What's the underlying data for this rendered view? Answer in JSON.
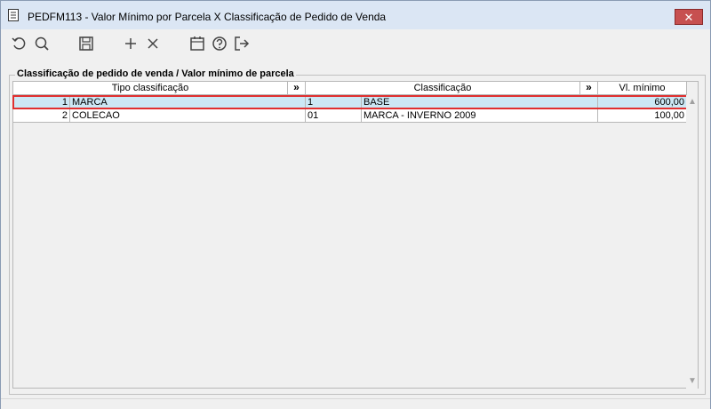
{
  "window": {
    "title": "PEDFM113 - Valor Mínimo por Parcela X Classificação de Pedido de Venda",
    "close_label": "✕"
  },
  "toolbar": {
    "buttons": [
      {
        "icon": "refresh-icon"
      },
      {
        "icon": "search-icon"
      },
      {
        "icon": "save-icon"
      },
      {
        "icon": "add-icon"
      },
      {
        "icon": "delete-icon"
      },
      {
        "icon": "calendar-icon"
      },
      {
        "icon": "help-icon"
      },
      {
        "icon": "exit-icon"
      }
    ]
  },
  "group": {
    "title": "Classificação de pedido de venda / Valor mínimo de parcela"
  },
  "grid": {
    "headers": {
      "tipo": "Tipo classificação",
      "tipo_btn": "»",
      "classificacao": "Classificação",
      "class_btn": "»",
      "valor": "Vl. mínimo"
    },
    "rows": [
      {
        "seq": "1",
        "tipo": "MARCA",
        "cod": "1",
        "classificacao": "BASE",
        "valor": "600,00",
        "selected": true
      },
      {
        "seq": "2",
        "tipo": "COLECAO",
        "cod": "01",
        "classificacao": "MARCA - INVERNO 2009",
        "valor": "100,00",
        "selected": false
      }
    ]
  },
  "scroll": {
    "up": "▲",
    "down": "▼"
  },
  "colors": {
    "selection": "#cce8f5",
    "highlight_frame": "#e03030",
    "close": "#c75050"
  }
}
